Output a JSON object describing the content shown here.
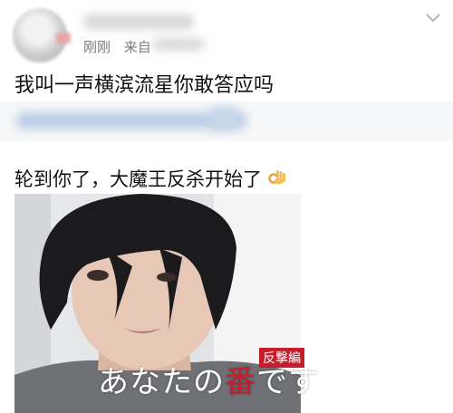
{
  "post": {
    "time_label": "刚刚",
    "source_label": "来自",
    "text": "我叫一声横滨流星你敢答应吗"
  },
  "repost": {
    "text": "轮到你了，大魔王反杀开始了",
    "emoji": "ok-hand-icon"
  },
  "image": {
    "caption_prefix": "あなたの",
    "caption_highlight": "番",
    "caption_suffix": "です",
    "stamp_text": "反撃編"
  },
  "colors": {
    "highlight_red": "#c71d2b",
    "meta_gray": "#7a7a7a"
  }
}
